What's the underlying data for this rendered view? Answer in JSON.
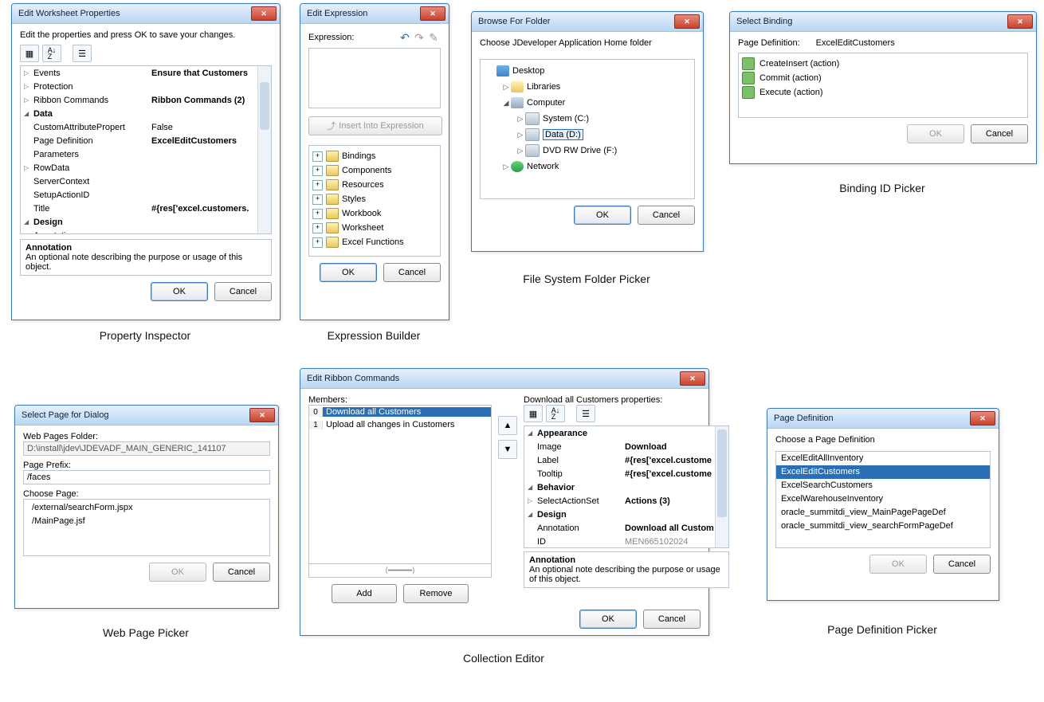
{
  "propInspector": {
    "title": "Edit Worksheet Properties",
    "desc": "Edit the properties and press OK to save your changes.",
    "rows": [
      {
        "tri": "▷",
        "k": "Events",
        "v": "Ensure that Customers",
        "kBold": false,
        "vBold": true,
        "indent": ""
      },
      {
        "tri": "▷",
        "k": "Protection",
        "v": "",
        "indent": ""
      },
      {
        "tri": "▷",
        "k": "Ribbon Commands",
        "v": "Ribbon Commands (2)",
        "vBold": true,
        "indent": ""
      },
      {
        "tri": "◢",
        "k": "Data",
        "v": "",
        "kBold": true,
        "indent": ""
      },
      {
        "tri": "",
        "k": "CustomAttributePropert",
        "v": "False",
        "indent": "indent1"
      },
      {
        "tri": "",
        "k": "Page Definition",
        "v": "ExcelEditCustomers",
        "vBold": true,
        "indent": "indent1"
      },
      {
        "tri": "",
        "k": "Parameters",
        "v": "",
        "indent": "indent1"
      },
      {
        "tri": "▷",
        "k": "RowData",
        "v": "",
        "indent": "indent1"
      },
      {
        "tri": "",
        "k": "ServerContext",
        "v": "",
        "indent": "indent1"
      },
      {
        "tri": "",
        "k": "SetupActionID",
        "v": "",
        "indent": "indent1"
      },
      {
        "tri": "",
        "k": "Title",
        "v": "#{res['excel.customers.",
        "vBold": true,
        "indent": "indent1"
      },
      {
        "tri": "◢",
        "k": "Design",
        "v": "",
        "kBold": true,
        "indent": ""
      },
      {
        "tri": "",
        "k": "Annotation",
        "v": "",
        "indent": "indent1"
      }
    ],
    "annTitle": "Annotation",
    "annText": "An optional note describing the purpose or usage of this object.",
    "ok": "OK",
    "cancel": "Cancel",
    "caption": "Property Inspector"
  },
  "exprBuilder": {
    "title": "Edit Expression",
    "exprLabel": "Expression:",
    "insertBtn": "Insert Into Expression",
    "tree": [
      "Bindings",
      "Components",
      "Resources",
      "Styles",
      "Workbook",
      "Worksheet",
      "Excel Functions"
    ],
    "ok": "OK",
    "cancel": "Cancel",
    "caption": "Expression Builder"
  },
  "folderPicker": {
    "title": "Browse For Folder",
    "desc": "Choose JDeveloper Application Home folder",
    "items": [
      {
        "exp": "",
        "ico": "desktop",
        "label": "Desktop",
        "indent": 0
      },
      {
        "exp": "▷",
        "ico": "lib",
        "label": "Libraries",
        "indent": 1
      },
      {
        "exp": "◢",
        "ico": "comp",
        "label": "Computer",
        "indent": 1
      },
      {
        "exp": "▷",
        "ico": "drive",
        "label": "System (C:)",
        "indent": 2
      },
      {
        "exp": "▷",
        "ico": "drive",
        "label": "Data (D:)",
        "indent": 2,
        "sel": true
      },
      {
        "exp": "▷",
        "ico": "drive",
        "label": "DVD RW Drive (F:)",
        "indent": 2
      },
      {
        "exp": "▷",
        "ico": "net",
        "label": "Network",
        "indent": 1
      }
    ],
    "ok": "OK",
    "cancel": "Cancel",
    "caption": "File System Folder Picker"
  },
  "bindingPicker": {
    "title": "Select Binding",
    "labelA": "Page Definition:",
    "labelB": "ExcelEditCustomers",
    "items": [
      "CreateInsert (action)",
      "Commit (action)",
      "Execute (action)"
    ],
    "ok": "OK",
    "cancel": "Cancel",
    "caption": "Binding ID Picker"
  },
  "webPagePicker": {
    "title": "Select Page for Dialog",
    "l1": "Web Pages Folder:",
    "v1": "D:\\install\\jdev\\JDEVADF_MAIN_GENERIC_141107",
    "l2": "Page Prefix:",
    "v2": "/faces",
    "l3": "Choose Page:",
    "pages": [
      "/external/searchForm.jspx",
      "/MainPage.jsf"
    ],
    "ok": "OK",
    "cancel": "Cancel",
    "caption": "Web Page Picker"
  },
  "collEditor": {
    "title": "Edit Ribbon Commands",
    "membersLabel": "Members:",
    "members": [
      {
        "i": "0",
        "t": "Download all Customers",
        "sel": true
      },
      {
        "i": "1",
        "t": "Upload all changes in Customers"
      }
    ],
    "add": "Add",
    "remove": "Remove",
    "propsLabel": "Download all Customers properties:",
    "rows": [
      {
        "tri": "◢",
        "k": "Appearance",
        "v": "",
        "kBold": true
      },
      {
        "tri": "",
        "k": "Image",
        "v": "Download",
        "vBold": true,
        "indent": "indent1"
      },
      {
        "tri": "",
        "k": "Label",
        "v": "#{res['excel.custome",
        "vBold": true,
        "indent": "indent1"
      },
      {
        "tri": "",
        "k": "Tooltip",
        "v": "#{res['excel.custome",
        "vBold": true,
        "indent": "indent1"
      },
      {
        "tri": "◢",
        "k": "Behavior",
        "v": "",
        "kBold": true
      },
      {
        "tri": "▷",
        "k": "SelectActionSet",
        "v": "Actions (3)",
        "vBold": true,
        "indent": "indent1"
      },
      {
        "tri": "◢",
        "k": "Design",
        "v": "",
        "kBold": true
      },
      {
        "tri": "",
        "k": "Annotation",
        "v": "Download all Custom",
        "vBold": true,
        "indent": "indent1"
      },
      {
        "tri": "",
        "k": "ID",
        "v": "MEN665102024",
        "indent": "indent1",
        "gray": true
      }
    ],
    "annTitle": "Annotation",
    "annText": "An optional note describing the purpose or usage of this object.",
    "ok": "OK",
    "cancel": "Cancel",
    "caption": "Collection Editor"
  },
  "pageDefPicker": {
    "title": "Page Definition",
    "desc": "Choose a Page Definition",
    "items": [
      {
        "t": "ExcelEditAllInventory"
      },
      {
        "t": "ExcelEditCustomers",
        "sel": true
      },
      {
        "t": "ExcelSearchCustomers"
      },
      {
        "t": "ExcelWarehouseInventory"
      },
      {
        "t": "oracle_summitdi_view_MainPagePageDef"
      },
      {
        "t": "oracle_summitdi_view_searchFormPageDef"
      }
    ],
    "ok": "OK",
    "cancel": "Cancel",
    "caption": "Page Definition Picker"
  }
}
